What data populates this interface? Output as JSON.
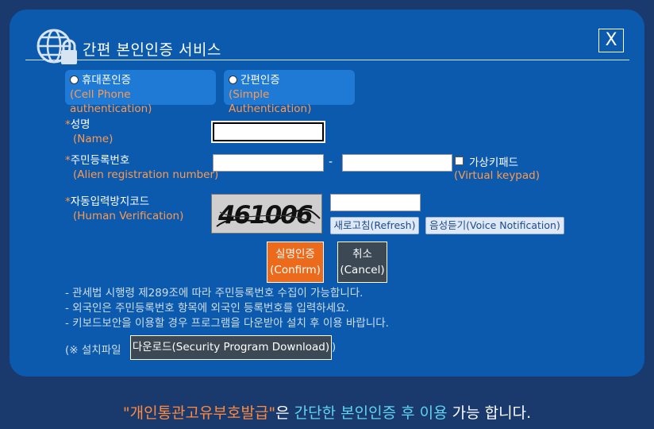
{
  "modal": {
    "title": "간편 본인인증 서비스",
    "close_label": "X"
  },
  "auth_options": [
    {
      "label": "휴대폰인증",
      "sub": "(Cell Phone authentication)"
    },
    {
      "label": "간편인증",
      "sub": "(Simple Authentication)"
    }
  ],
  "fields": {
    "name": {
      "star": "*",
      "label": "성명",
      "sub": "(Name)",
      "value": ""
    },
    "alien_reg": {
      "star": "*",
      "label": "주민등록번호",
      "sub": "(Alien registration number)",
      "value1": "",
      "value2": "",
      "separator": "-"
    },
    "virtual_keypad": {
      "label": "가상키패드",
      "sub": "(Virtual keypad)",
      "checked": false
    },
    "captcha": {
      "star": "*",
      "label": "자동입력방지코드",
      "sub": "(Human Verification)",
      "image_text": "461006",
      "value": ""
    }
  },
  "buttons": {
    "refresh": "새로고침(Refresh)",
    "voice": "음성듣기(Voice Notification)",
    "confirm_line1": "실명인증",
    "confirm_line2": "(Confirm)",
    "cancel_line1": "취소",
    "cancel_line2": "(Cancel)",
    "download": "다운로드(Security Program Download)"
  },
  "notes": [
    "- 관세법 시행령 제289조에 따라 주민등록번호 수집이 가능합니다.",
    "- 외국인은 주민등록번호 항목에 외국인 등록번호를 입력하세요.",
    "- 키보드보안을 이용할 경우 프로그램을 다운받아 설치 후 이용 바랍니다."
  ],
  "install": {
    "prefix": "(※ 설치파일",
    "suffix": ")"
  },
  "footer": {
    "part1": "\"개인통관고유부호발급\"",
    "part2": "은 ",
    "part3": "간단한 본인인증 후 이용",
    "part4": " 가능 합니다."
  },
  "colors": {
    "modal_bg": "#0b5aad",
    "page_bg": "#1a3a6e",
    "accent_orange": "#ec6a1b",
    "label_orange": "#ff9a4d",
    "cyan": "#5fd3f0"
  },
  "icons": {
    "title": "globe-lock-icon"
  }
}
